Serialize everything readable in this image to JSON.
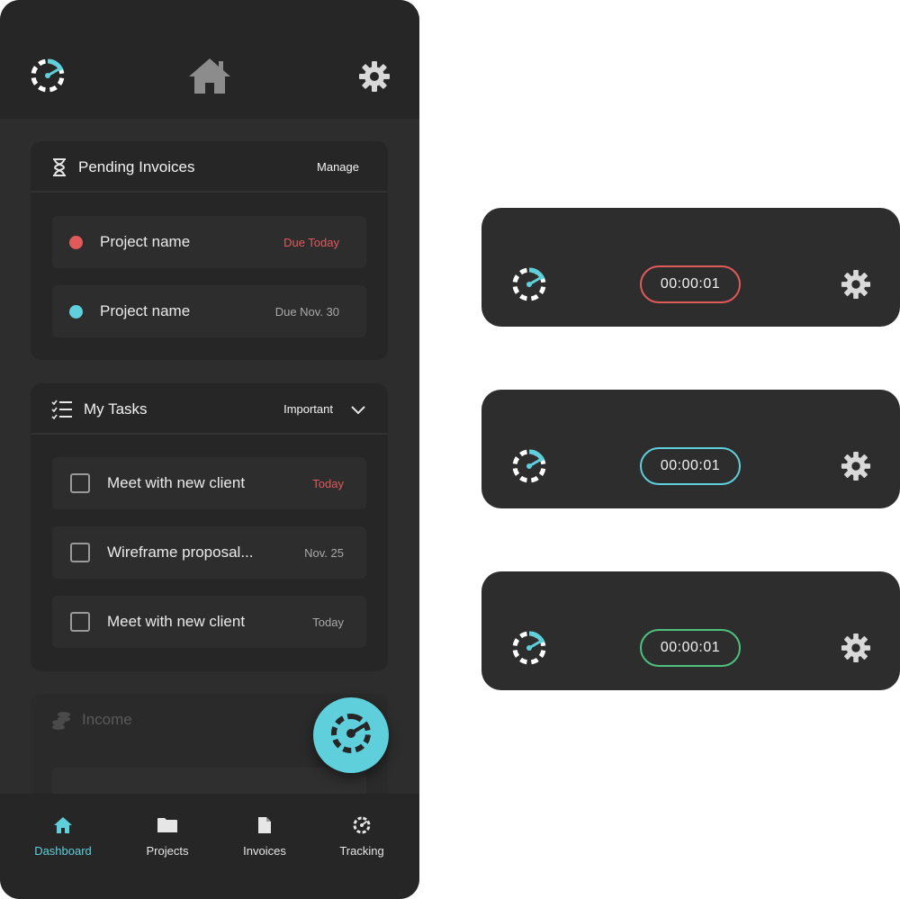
{
  "colors": {
    "accent": "#5fcfdb",
    "red": "#e05a5a",
    "green": "#4cc27d",
    "background": "#2d2d2d",
    "surface": "#262626"
  },
  "header": {
    "logo_icon": "speedometer-logo-icon",
    "center_icon": "home-icon",
    "right_icon": "gear-icon"
  },
  "pending_invoices": {
    "title": "Pending Invoices",
    "action": "Manage",
    "items": [
      {
        "label": "Project name",
        "status": "Due Today",
        "dot_color": "#e05a5a",
        "status_color": "#e05a5a"
      },
      {
        "label": "Project name",
        "status": "Due Nov. 30",
        "dot_color": "#5fcfdb",
        "status_color": "#a9a9a9"
      }
    ]
  },
  "my_tasks": {
    "title": "My Tasks",
    "filter": "Important",
    "items": [
      {
        "label": "Meet with new client",
        "date": "Today",
        "date_color": "#e05a5a"
      },
      {
        "label": "Wireframe proposal...",
        "date": "Nov. 25",
        "date_color": "#a9a9a9"
      },
      {
        "label": "Meet with new client",
        "date": "Today",
        "date_color": "#a9a9a9"
      }
    ]
  },
  "income": {
    "title": "Income"
  },
  "fab": {
    "icon": "speedometer-icon"
  },
  "bottom_nav": [
    {
      "label": "Dashboard",
      "icon": "home-icon",
      "active": true
    },
    {
      "label": "Projects",
      "icon": "folder-icon",
      "active": false
    },
    {
      "label": "Invoices",
      "icon": "document-icon",
      "active": false
    },
    {
      "label": "Tracking",
      "icon": "speedometer-icon",
      "active": false
    }
  ],
  "timers": [
    {
      "time": "00:00:01",
      "color": "#e05a5a"
    },
    {
      "time": "00:00:01",
      "color": "#5fcfdb"
    },
    {
      "time": "00:00:01",
      "color": "#4cc27d"
    }
  ]
}
